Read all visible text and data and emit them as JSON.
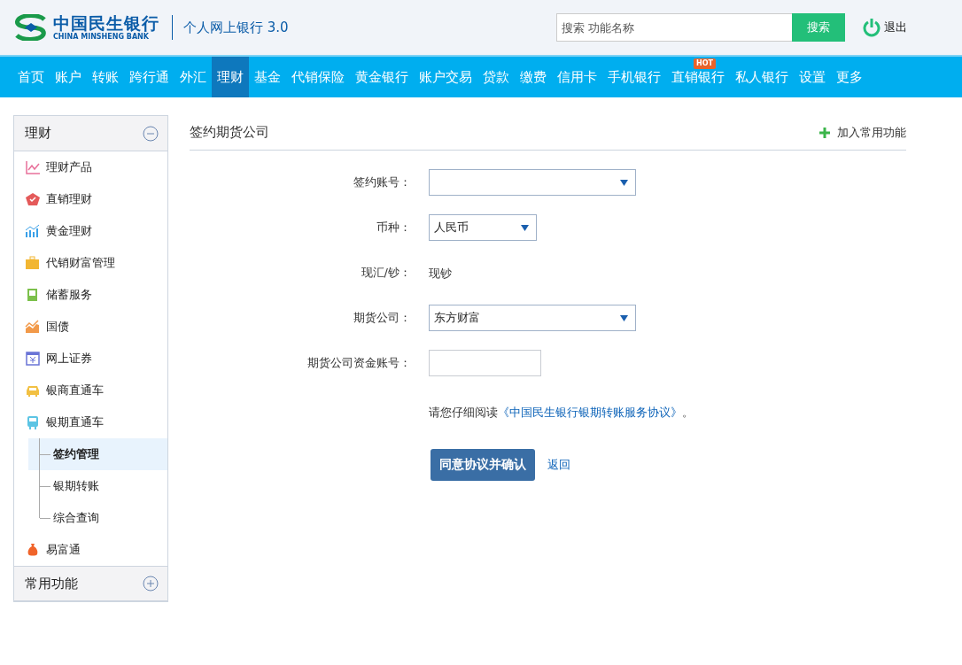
{
  "header": {
    "logo_cn": "中国民生银行",
    "logo_en": "CHINA MINSHENG BANK",
    "product": "个人网上银行 3.0",
    "search": {
      "placeholder": "搜索 功能名称",
      "button": "搜索"
    },
    "logout": "退出"
  },
  "nav": [
    {
      "label": "首页",
      "selected": false
    },
    {
      "label": "账户",
      "selected": false
    },
    {
      "label": "转账",
      "selected": false
    },
    {
      "label": "跨行通",
      "selected": false
    },
    {
      "label": "外汇",
      "selected": false
    },
    {
      "label": "理财",
      "selected": true
    },
    {
      "label": "基金",
      "selected": false
    },
    {
      "label": "代销保险",
      "selected": false
    },
    {
      "label": "黄金银行",
      "selected": false
    },
    {
      "label": "账户交易",
      "selected": false
    },
    {
      "label": "贷款",
      "selected": false
    },
    {
      "label": "缴费",
      "selected": false
    },
    {
      "label": "信用卡",
      "selected": false
    },
    {
      "label": "手机银行",
      "selected": false
    },
    {
      "label": "直销银行",
      "selected": false,
      "badge": "HOT"
    },
    {
      "label": "私人银行",
      "selected": false
    },
    {
      "label": "设置",
      "selected": false
    },
    {
      "label": "更多",
      "selected": false
    }
  ],
  "sidebar": {
    "sections": [
      {
        "title": "理财",
        "expanded": true,
        "items": [
          {
            "label": "理财产品"
          },
          {
            "label": "直销理财"
          },
          {
            "label": "黄金理财"
          },
          {
            "label": "代销财富管理"
          },
          {
            "label": "储蓄服务"
          },
          {
            "label": "国债"
          },
          {
            "label": "网上证券"
          },
          {
            "label": "银商直通车"
          },
          {
            "label": "银期直通车",
            "children": [
              {
                "label": "签约管理",
                "selected": true
              },
              {
                "label": "银期转账",
                "selected": false
              },
              {
                "label": "综合查询",
                "selected": false
              }
            ]
          },
          {
            "label": "易富通"
          }
        ]
      },
      {
        "title": "常用功能",
        "expanded": false
      }
    ]
  },
  "page": {
    "title": "签约期货公司",
    "add_favorite": "加入常用功能",
    "fields": [
      {
        "kind": "select",
        "label": "签约账号："
      },
      {
        "kind": "shortselect",
        "label": "币种：",
        "value": "人民币"
      },
      {
        "kind": "text",
        "label": "现汇/钞：",
        "value": "现钞"
      },
      {
        "kind": "select",
        "label": "期货公司：",
        "value": "东方财富"
      },
      {
        "kind": "input",
        "label": "期货公司资金账号："
      }
    ],
    "notice": {
      "prefix": "请您仔细阅读",
      "link": "《中国民生银行银期转账服务协议》",
      "suffix": "。"
    },
    "confirm": "同意协议并确认",
    "back": "返回"
  }
}
